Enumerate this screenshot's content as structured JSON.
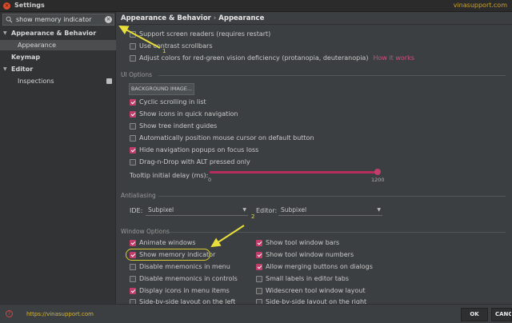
{
  "window": {
    "title": "Settings",
    "watermark": "vinasupport.com",
    "close_glyph": "×"
  },
  "search": {
    "value": "show memory indicator",
    "clear_glyph": "×"
  },
  "tree": [
    {
      "label": "Appearance & Behavior",
      "bold": true,
      "expanded": true
    },
    {
      "label": "Appearance",
      "selected": true
    },
    {
      "label": "Keymap",
      "bold": true
    },
    {
      "label": "Editor",
      "bold": true,
      "expanded": true
    },
    {
      "label": "Inspections"
    }
  ],
  "breadcrumb": {
    "parent": "Appearance & Behavior",
    "sep": "›",
    "current": "Appearance"
  },
  "accessibility": [
    {
      "label": "Support screen readers (requires restart)",
      "checked": false
    },
    {
      "label": "Use contrast scrollbars",
      "checked": false
    },
    {
      "label": "Adjust colors for red-green vision deficiency (protanopia, deuteranopia)",
      "checked": false,
      "link": "How it works"
    }
  ],
  "ui_options": {
    "title": "UI Options",
    "background_button": "BACKGROUND IMAGE...",
    "items": [
      {
        "label": "Cyclic scrolling in list",
        "checked": true
      },
      {
        "label": "Show icons in quick navigation",
        "checked": true
      },
      {
        "label": "Show tree indent guides",
        "checked": false
      },
      {
        "label": "Automatically position mouse cursor on default button",
        "checked": false
      },
      {
        "label": "Hide navigation popups on focus loss",
        "checked": true
      },
      {
        "label": "Drag-n-Drop with ALT pressed only",
        "checked": false
      }
    ],
    "tooltip_label": "Tooltip initial delay (ms):",
    "tooltip_min": "0",
    "tooltip_max": "1200",
    "tooltip_fraction": 1.0
  },
  "antialiasing": {
    "title": "Antialiasing",
    "ide_label": "IDE:",
    "ide_value": "Subpixel",
    "editor_label": "Editor:",
    "editor_value": "Subpixel",
    "arrow_glyph": "▼"
  },
  "window_options": {
    "title": "Window Options",
    "left": [
      {
        "label": "Animate windows",
        "checked": true
      },
      {
        "label": "Show memory indicator",
        "checked": true
      },
      {
        "label": "Disable mnemonics in menu",
        "checked": false
      },
      {
        "label": "Disable mnemonics in controls",
        "checked": false
      },
      {
        "label": "Display icons in menu items",
        "checked": true
      },
      {
        "label": "Side-by-side layout on the left",
        "checked": false
      }
    ],
    "right": [
      {
        "label": "Show tool window bars",
        "checked": true
      },
      {
        "label": "Show tool window numbers",
        "checked": true
      },
      {
        "label": "Allow merging buttons on dialogs",
        "checked": true
      },
      {
        "label": "Small labels in editor tabs",
        "checked": false
      },
      {
        "label": "Widescreen tool window layout",
        "checked": false
      },
      {
        "label": "Side-by-side layout on the right",
        "checked": false
      }
    ]
  },
  "annotations": {
    "step1": "1",
    "step2": "2",
    "arrow_color": "#e8df3a"
  },
  "footer": {
    "help_glyph": "?",
    "url": "https://vinasupport.com",
    "ok": "OK",
    "cancel": "CANCEL"
  },
  "colors": {
    "accent": "#c23d6a",
    "link": "#d14f7d",
    "highlight": "#d8cc2f"
  }
}
